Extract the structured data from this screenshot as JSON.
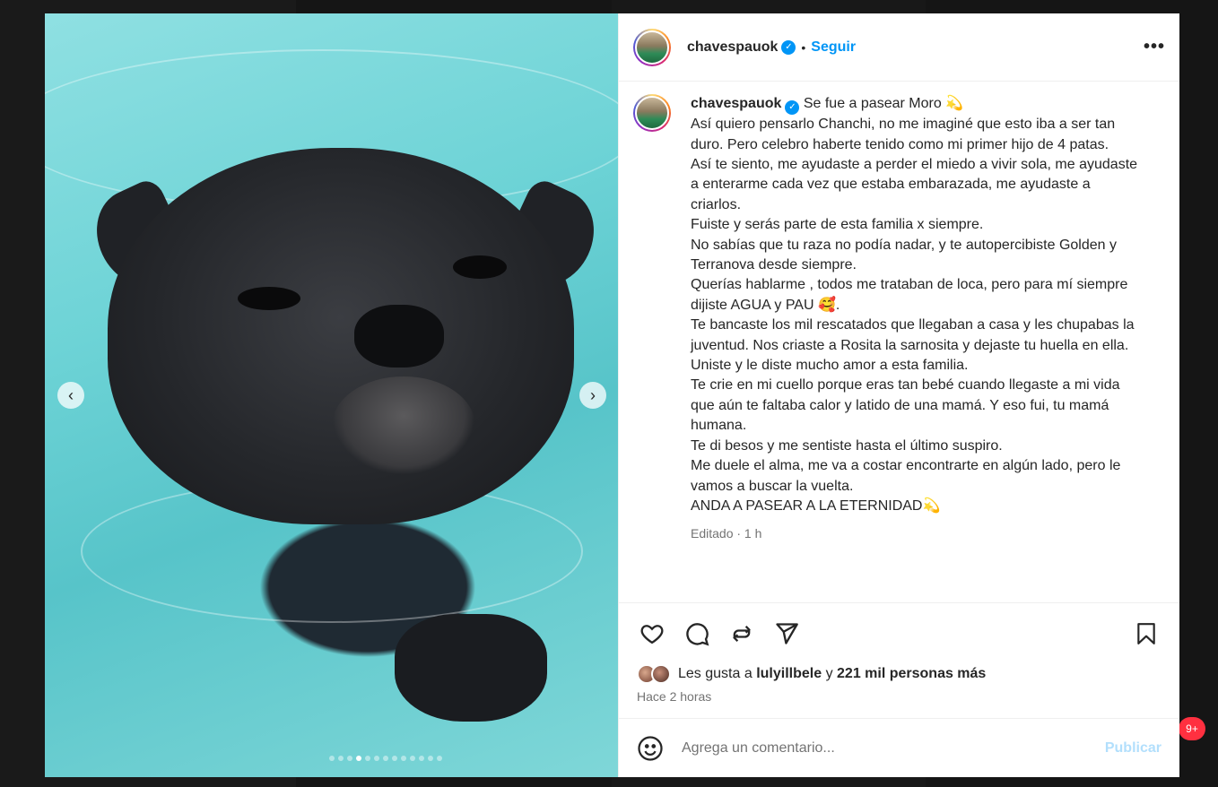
{
  "notification_count": "9+",
  "header": {
    "username": "chavespauok",
    "separator": "•",
    "follow_label": "Seguir",
    "more_label": "•••"
  },
  "caption": {
    "username": "chavespauok",
    "lines": [
      "Se fue a pasear Moro 💫",
      "Así quiero pensarlo Chanchi, no me imaginé que esto iba a ser tan duro. Pero celebro haberte tenido como mi primer hijo de 4 patas.",
      "Así te siento, me ayudaste a perder el miedo a vivir sola, me ayudaste a enterarme cada vez que estaba embarazada, me ayudaste a criarlos.",
      "Fuiste y serás parte de esta familia x siempre.",
      "No sabías que tu raza no podía nadar, y te autopercibiste Golden y Terranova desde siempre.",
      "Querías hablarme , todos me trataban de loca, pero para mí siempre dijiste AGUA y PAU 🥰.",
      "Te bancaste los mil rescatados que llegaban a casa y les chupabas la juventud. Nos criaste a Rosita la sarnosita y dejaste tu huella en ella.",
      "Uniste y le diste mucho amor a esta familia.",
      "Te crie en mi cuello porque eras tan bebé cuando llegaste a mi vida que aún te faltaba calor y latido de una mamá. Y eso fui, tu mamá humana.",
      "Te di besos y me sentiste hasta el último suspiro.",
      "Me duele el alma, me va a costar encontrarte en algún lado, pero le vamos a buscar la vuelta.",
      "ANDA A PASEAR A LA ETERNIDAD💫"
    ],
    "meta": "Editado · 1 h"
  },
  "likes": {
    "prefix": "Les gusta a",
    "user": "lulyillbele",
    "joiner": "y",
    "count_text": "221 mil personas más"
  },
  "timestamp": "Hace 2 horas",
  "comment": {
    "placeholder": "Agrega un comentario...",
    "publish_label": "Publicar"
  },
  "carousel": {
    "total": 13,
    "active_index": 3,
    "prev_label": "‹",
    "next_label": "›"
  }
}
